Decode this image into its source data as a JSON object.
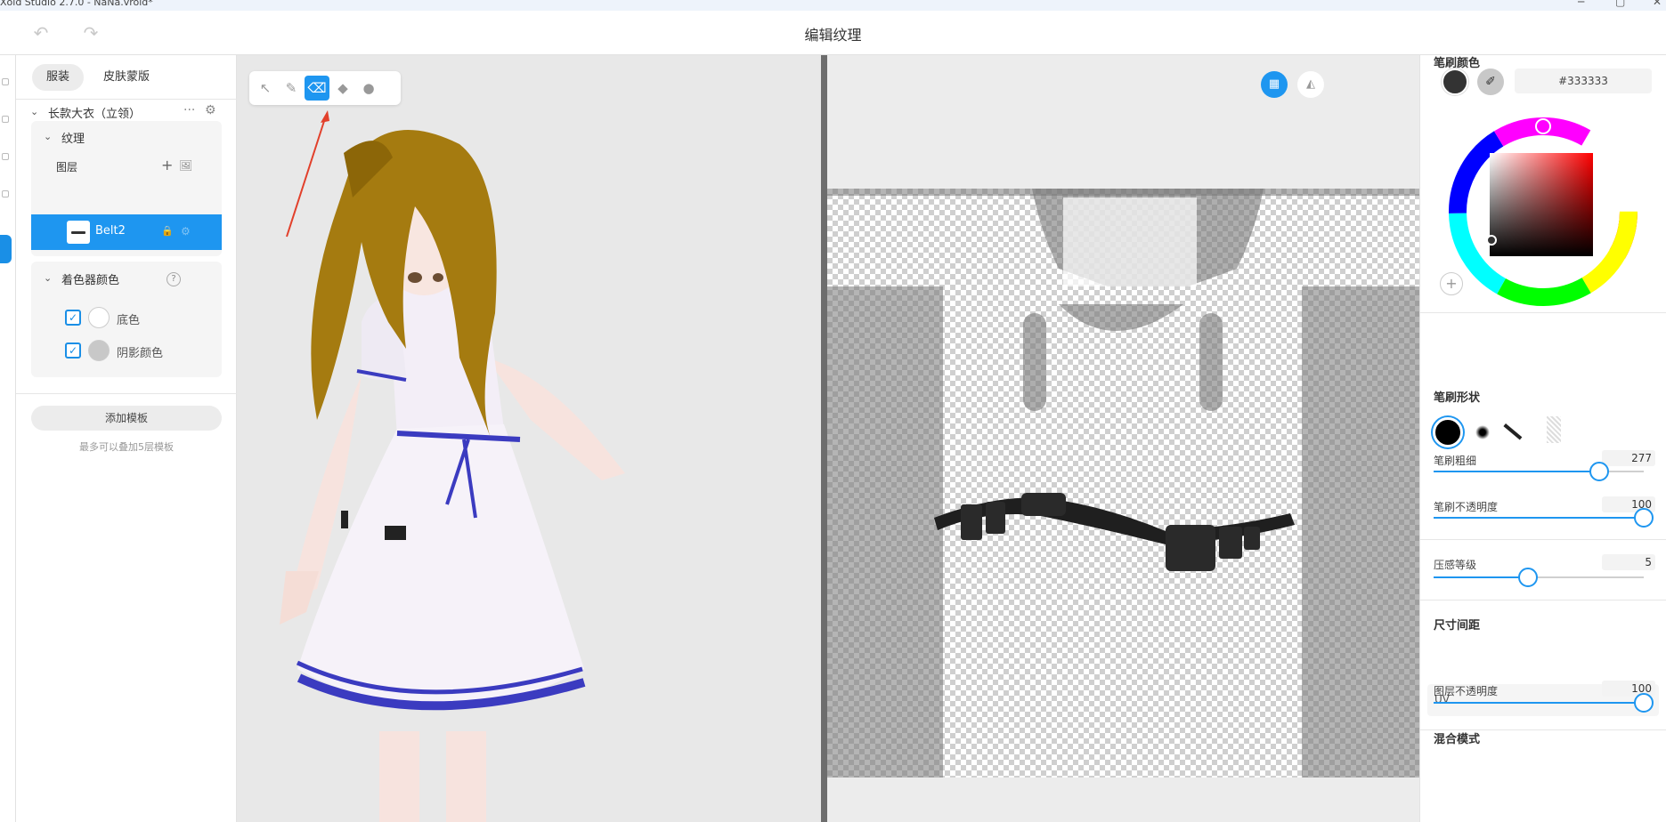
{
  "window": {
    "title": "Xoid Studio 2.7.0 - NaNa.vroid*",
    "minimize": "─",
    "maximize": "▢",
    "close": "✕"
  },
  "header": {
    "title": "编辑纹理",
    "undo": "↶",
    "redo": "↷"
  },
  "left_panel": {
    "tabs": [
      "服装",
      "皮肤蒙版"
    ],
    "garment": {
      "name": "长款大衣（立领）",
      "more": "···",
      "settings": "⚙"
    },
    "texture": {
      "title": "纹理",
      "layers_label": "图层",
      "add": "+",
      "add_image": "🖼"
    },
    "layer": {
      "name": "Belt2",
      "lock": "🔒",
      "gear": "⚙"
    },
    "shader": {
      "title": "着色器颜色",
      "help": "?",
      "items": [
        {
          "label": "底色",
          "checked": true,
          "color": "#ffffff"
        },
        {
          "label": "阴影颜色",
          "checked": true,
          "color": "#c8c8c8"
        }
      ]
    },
    "add_template": "添加模板",
    "template_hint": "最多可以叠加5层模板"
  },
  "toolbar": {
    "tools": [
      {
        "name": "select",
        "glyph": "↖"
      },
      {
        "name": "pen",
        "glyph": "✎"
      },
      {
        "name": "eraser",
        "glyph": "⌫"
      },
      {
        "name": "fill",
        "glyph": "◆"
      },
      {
        "name": "dropper",
        "glyph": "●"
      }
    ],
    "active": "eraser"
  },
  "uv_view": {
    "grid_btn": "▦",
    "mirror_btn": "◭"
  },
  "right_panel": {
    "brush_color": {
      "title": "笔刷颜色",
      "hex": "#333333",
      "add": "+"
    },
    "brush_shape": {
      "title": "笔刷形状"
    },
    "sliders": [
      {
        "label": "笔刷粗细",
        "value": "277",
        "fraction": 0.79
      },
      {
        "label": "笔刷不透明度",
        "value": "100",
        "fraction": 1.0
      },
      {
        "label": "压感等级",
        "value": "5",
        "fraction": 0.45
      }
    ],
    "size_spacing": {
      "title": "尺寸间距",
      "selected": "UV"
    },
    "layer_opacity": {
      "label": "图层不透明度",
      "value": "100",
      "fraction": 1.0
    },
    "blend_mode": {
      "title": "混合模式"
    }
  },
  "colors": {
    "accent": "#1e96f0",
    "brush": "#333333"
  }
}
